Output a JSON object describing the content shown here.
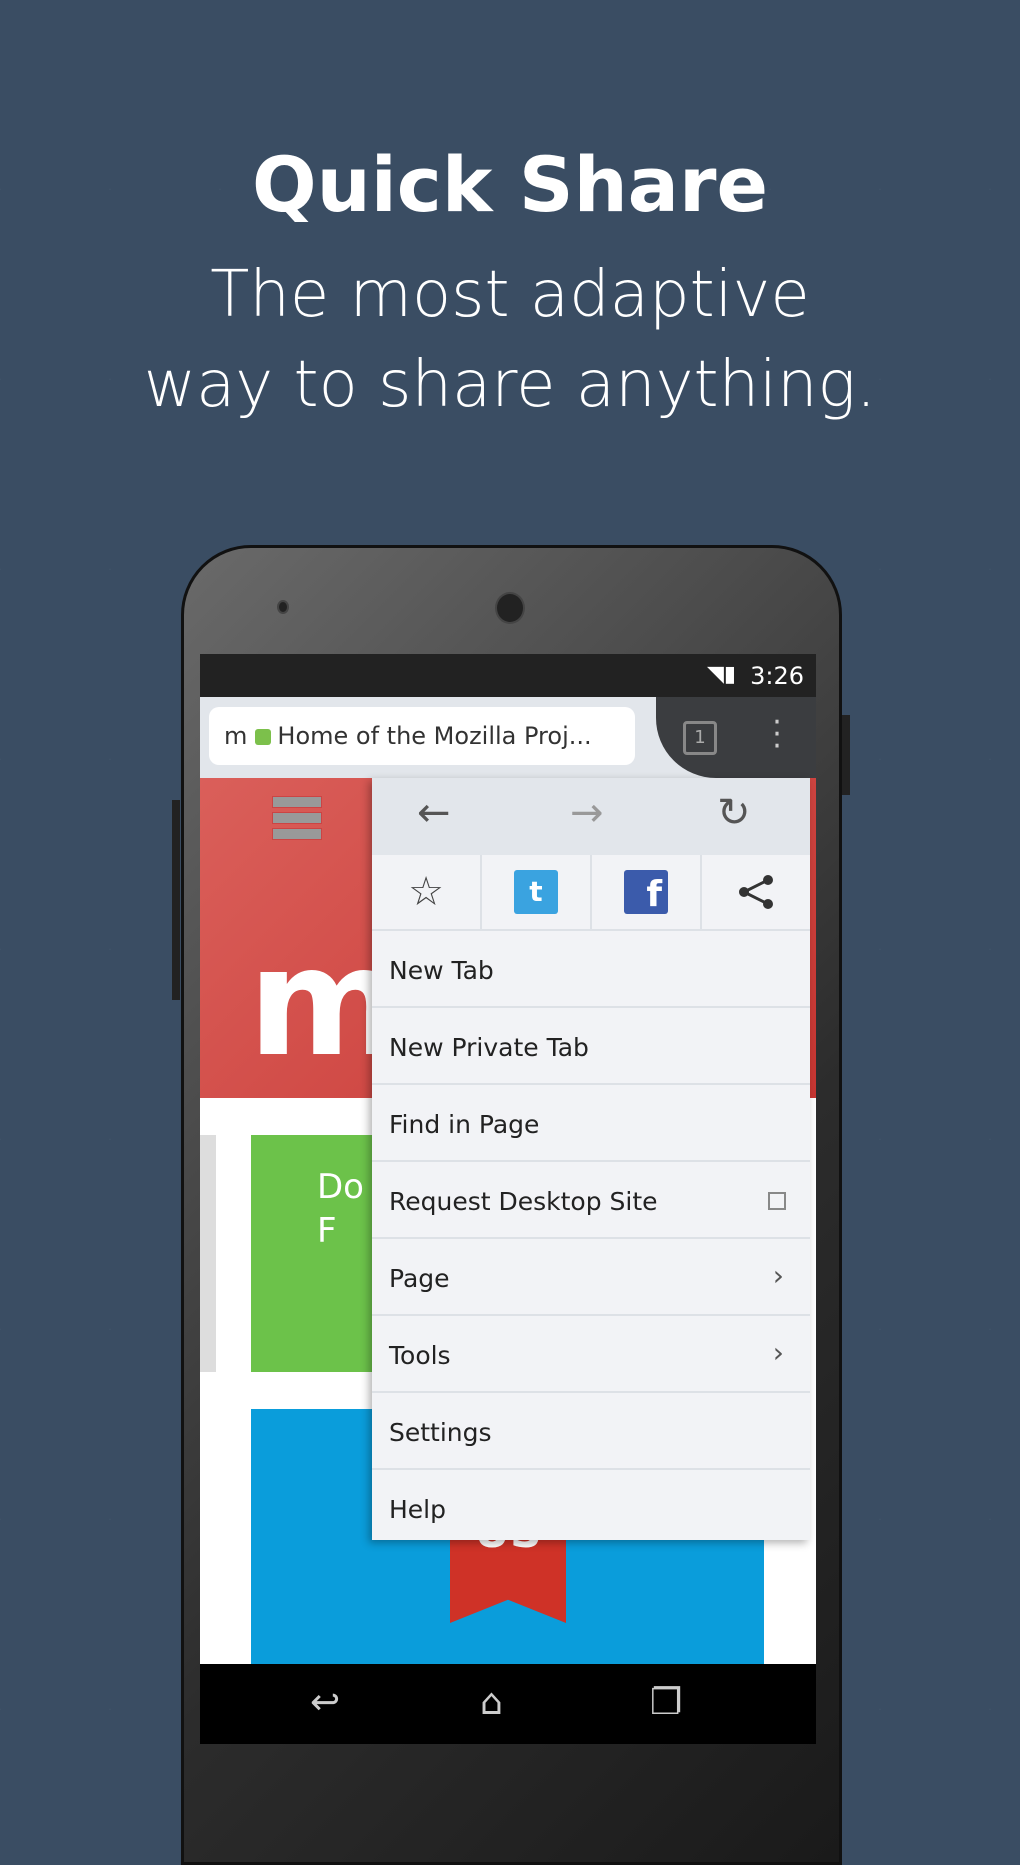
{
  "headline": {
    "title": "Quick Share",
    "subtitle_line1": "The most adaptive",
    "subtitle_line2": "way to share anything."
  },
  "status_bar": {
    "time": "3:26",
    "icons": [
      "wifi-icon",
      "signal-icon",
      "battery-icon"
    ]
  },
  "url_bar": {
    "site_icon": "m",
    "title": "Home of the Mozilla Proj...",
    "tab_count": "1"
  },
  "page": {
    "logo_letter": "m",
    "green_text": "Do\nF",
    "ribbon_text": "US"
  },
  "menu": {
    "nav": [
      "back-icon",
      "forward-icon",
      "reload-icon"
    ],
    "share": [
      "star-icon",
      "twitter-icon",
      "facebook-icon",
      "share-icon"
    ],
    "items": [
      {
        "label": "New Tab"
      },
      {
        "label": "New Private Tab"
      },
      {
        "label": "Find in Page"
      },
      {
        "label": "Request Desktop Site",
        "checkbox": false
      },
      {
        "label": "Page",
        "submenu": true
      },
      {
        "label": "Tools",
        "submenu": true
      },
      {
        "label": "Settings"
      },
      {
        "label": "Help"
      }
    ]
  },
  "colors": {
    "background": "#3a4d63",
    "mozilla_red": "#c73632",
    "green": "#6cc24a",
    "blue": "#0a9ddb",
    "lock": "#7cc04b"
  }
}
